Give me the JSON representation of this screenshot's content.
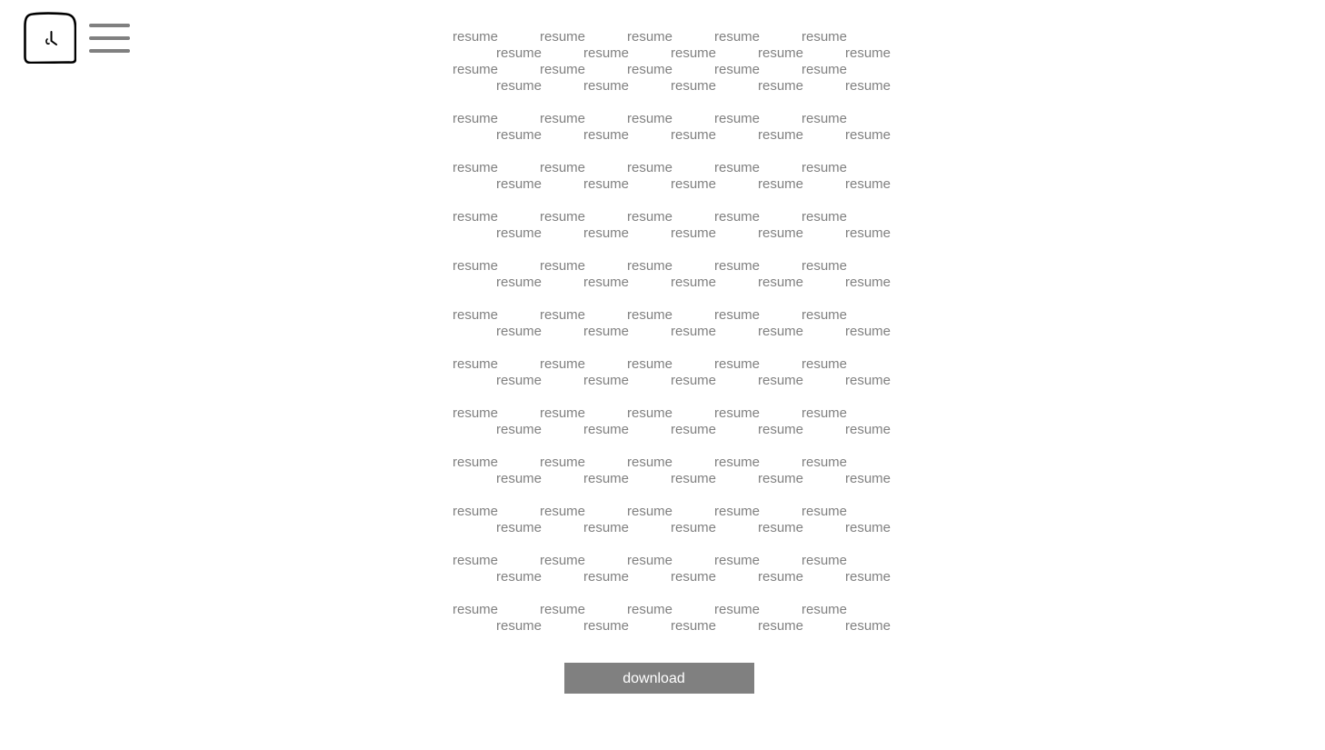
{
  "header": {
    "logo_icon": "stopwatch-icon",
    "menu_icon": "hamburger-menu-icon"
  },
  "resume_grid": {
    "rows": [
      {
        "words": [
          "resume",
          "resume",
          "resume",
          "resume",
          "resume"
        ]
      },
      {
        "words": [
          "resume",
          "resume",
          "resume",
          "resume",
          "resume"
        ]
      },
      {
        "words": [
          "resume",
          "resume",
          "resume",
          "resume",
          "resume"
        ]
      },
      {
        "words": [
          "resume",
          "resume",
          "resume",
          "resume",
          "resume"
        ]
      },
      {
        "words": [
          "resume",
          "resume",
          "resume",
          "resume",
          "resume"
        ]
      },
      {
        "words": [
          "resume",
          "resume",
          "resume",
          "resume",
          "resume"
        ]
      },
      {
        "words": [
          "resume",
          "resume",
          "resume",
          "resume",
          "resume"
        ]
      },
      {
        "words": [
          "resume",
          "resume",
          "resume",
          "resume",
          "resume"
        ]
      },
      {
        "words": [
          "resume",
          "resume",
          "resume",
          "resume",
          "resume"
        ]
      },
      {
        "words": [
          "resume",
          "resume",
          "resume",
          "resume",
          "resume"
        ]
      },
      {
        "words": [
          "resume",
          "resume",
          "resume",
          "resume",
          "resume"
        ]
      },
      {
        "words": [
          "resume",
          "resume",
          "resume",
          "resume",
          "resume"
        ]
      },
      {
        "words": [
          "resume",
          "resume",
          "resume",
          "resume",
          "resume"
        ]
      },
      {
        "words": [
          "resume",
          "resume",
          "resume",
          "resume",
          "resume"
        ]
      },
      {
        "words": [
          "resume",
          "resume",
          "resume",
          "resume",
          "resume"
        ]
      },
      {
        "words": [
          "resume",
          "resume",
          "resume",
          "resume",
          "resume"
        ]
      },
      {
        "words": [
          "resume",
          "resume",
          "resume",
          "resume",
          "resume"
        ]
      },
      {
        "words": [
          "resume",
          "resume",
          "resume",
          "resume",
          "resume"
        ]
      },
      {
        "words": [
          "resume",
          "resume",
          "resume",
          "resume",
          "resume"
        ]
      },
      {
        "words": [
          "resume",
          "resume",
          "resume",
          "resume",
          "resume"
        ]
      },
      {
        "words": [
          "resume",
          "resume",
          "resume",
          "resume",
          "resume"
        ]
      },
      {
        "words": [
          "resume",
          "resume",
          "resume",
          "resume",
          "resume"
        ]
      },
      {
        "words": [
          "resume",
          "resume",
          "resume",
          "resume",
          "resume"
        ]
      },
      {
        "words": [
          "resume",
          "resume",
          "resume",
          "resume",
          "resume"
        ]
      },
      {
        "words": [
          "resume",
          "resume",
          "resume",
          "resume",
          "resume"
        ]
      },
      {
        "words": [
          "resume",
          "resume",
          "resume",
          "resume",
          "resume"
        ]
      }
    ]
  },
  "download_button": {
    "label": "download"
  },
  "colors": {
    "text": "#808080",
    "button_bg": "#808080",
    "button_text": "#ffffff",
    "background": "#ffffff"
  }
}
